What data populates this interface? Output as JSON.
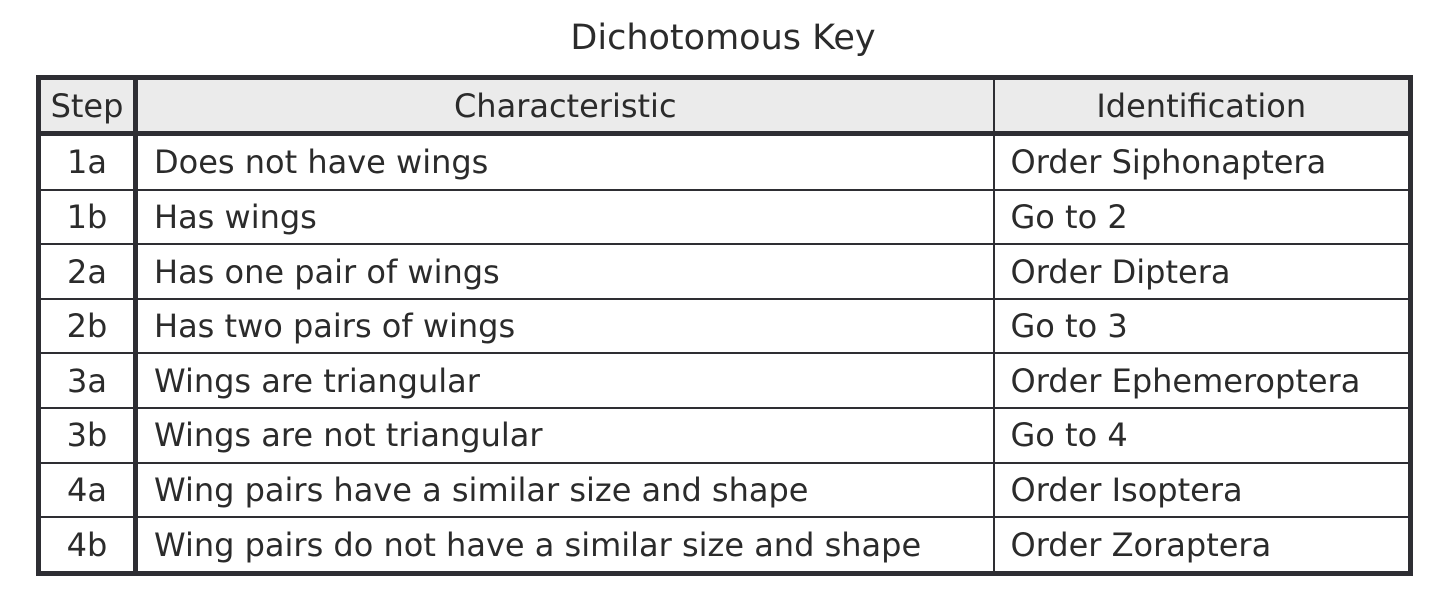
{
  "title": "Dichotomous Key",
  "table": {
    "headers": {
      "step": "Step",
      "characteristic": "Characteristic",
      "identification": "Identification"
    },
    "rows": [
      {
        "step": "1a",
        "characteristic": "Does not have wings",
        "identification": "Order Siphonaptera"
      },
      {
        "step": "1b",
        "characteristic": "Has wings",
        "identification": "Go to 2"
      },
      {
        "step": "2a",
        "characteristic": "Has one pair of wings",
        "identification": "Order Diptera"
      },
      {
        "step": "2b",
        "characteristic": "Has two pairs of wings",
        "identification": "Go to 3"
      },
      {
        "step": "3a",
        "characteristic": "Wings are triangular",
        "identification": "Order Ephemeroptera"
      },
      {
        "step": "3b",
        "characteristic": "Wings are not triangular",
        "identification": "Go to 4"
      },
      {
        "step": "4a",
        "characteristic": "Wing pairs have a similar size and shape",
        "identification": "Order Isoptera"
      },
      {
        "step": "4b",
        "characteristic": "Wing pairs do not have a similar size and shape",
        "identification": "Order Zoraptera"
      }
    ]
  }
}
